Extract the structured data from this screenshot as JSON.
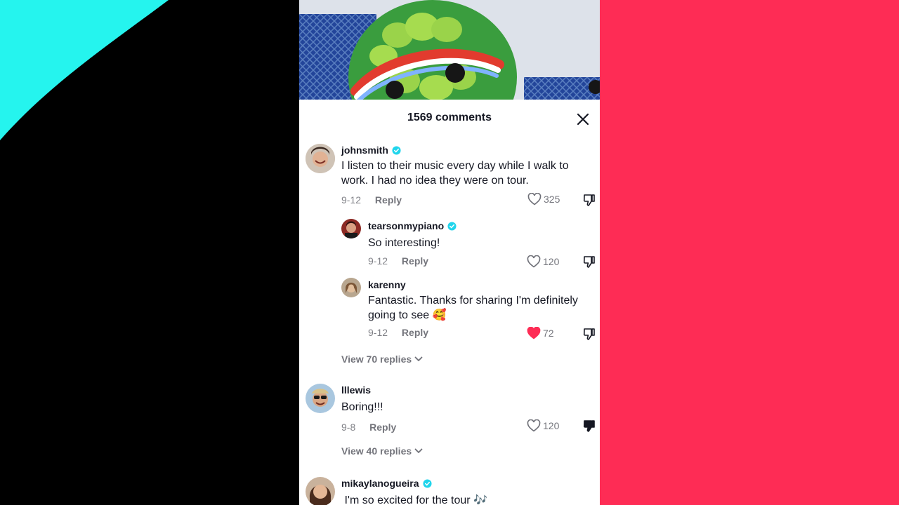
{
  "colors": {
    "accent_red": "#fe2c55",
    "accent_cyan": "#25f4ee",
    "verified_blue": "#20d5ec"
  },
  "comments_header": {
    "title": "1569 comments",
    "close_icon": "close-icon"
  },
  "comments": [
    {
      "username": "johnsmith",
      "verified": true,
      "text": "I listen to their music every day while I walk to work. I had no idea they were on tour.",
      "date": "9-12",
      "reply_label": "Reply",
      "likes": "325",
      "liked": false,
      "disliked": false,
      "replies": [
        {
          "username": "tearsonmypiano",
          "verified": true,
          "text": "So interesting!",
          "date": "9-12",
          "reply_label": "Reply",
          "likes": "120",
          "liked": false,
          "disliked": false
        },
        {
          "username": "karenny",
          "verified": false,
          "text": "Fantastic. Thanks for sharing I'm definitely going to see 🥰",
          "date": "9-12",
          "reply_label": "Reply",
          "likes": "72",
          "liked": true,
          "disliked": false
        }
      ],
      "view_replies_label": "View 70 replies"
    },
    {
      "username": "lllewis",
      "verified": false,
      "text": "Boring!!!",
      "date": "9-8",
      "reply_label": "Reply",
      "likes": "120",
      "liked": false,
      "disliked": true,
      "view_replies_label": "View 40 replies"
    },
    {
      "username": "mikaylanogueira",
      "verified": true,
      "text": " I'm so excited for the tour 🎶"
    }
  ]
}
